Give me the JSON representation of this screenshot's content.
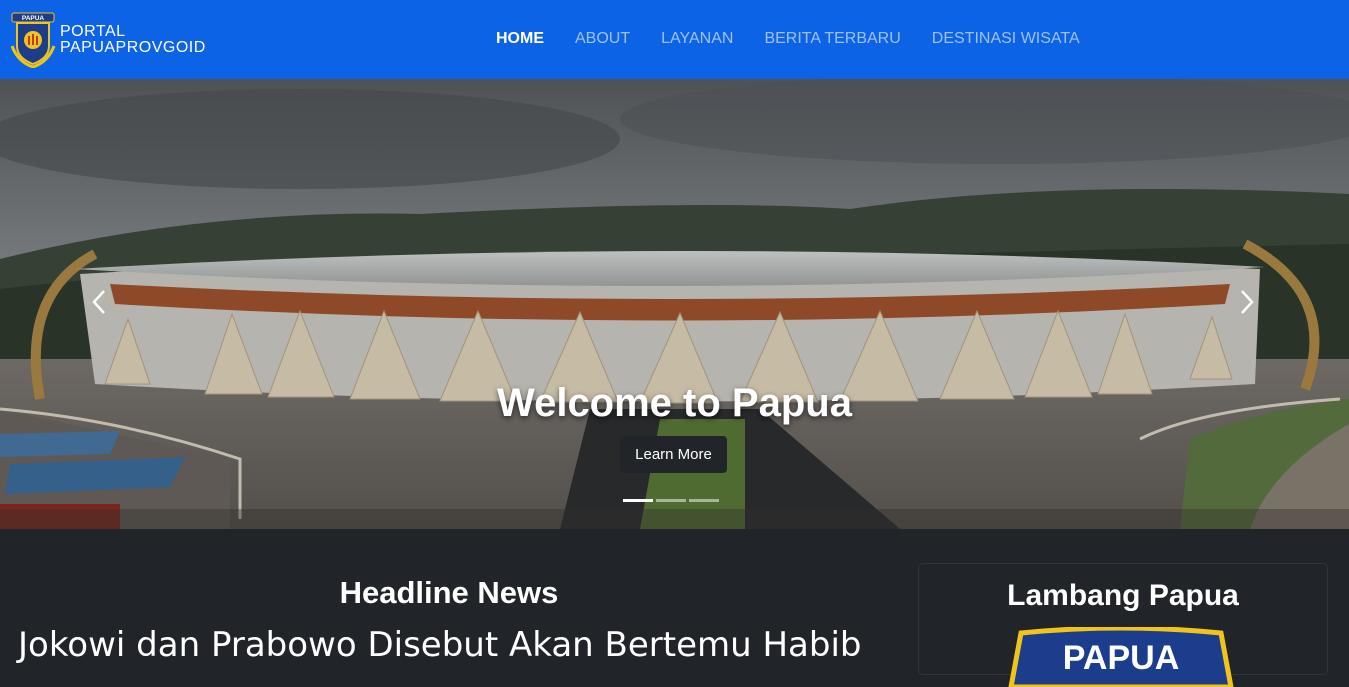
{
  "brand": {
    "line1": "PORTAL",
    "line2": "PAPUAPROVGOID",
    "logo_text": "PAPUA"
  },
  "nav": [
    {
      "label": "HOME",
      "active": true
    },
    {
      "label": "ABOUT"
    },
    {
      "label": "LAYANAN"
    },
    {
      "label": "BERITA TERBARU"
    },
    {
      "label": "DESTINASI WISATA"
    }
  ],
  "hero": {
    "title": "Welcome to Papua",
    "button": "Learn More",
    "slides_total": 3,
    "active_slide": 1
  },
  "headline": {
    "title": "Headline News",
    "text": "Jokowi dan Prabowo Disebut Akan Bertemu Habib"
  },
  "sidebar": {
    "title": "Lambang Papua",
    "emblem_text": "PAPUA"
  },
  "colors": {
    "navbar": "#0d63e6",
    "body": "#212529",
    "accent": "#f0c419"
  }
}
